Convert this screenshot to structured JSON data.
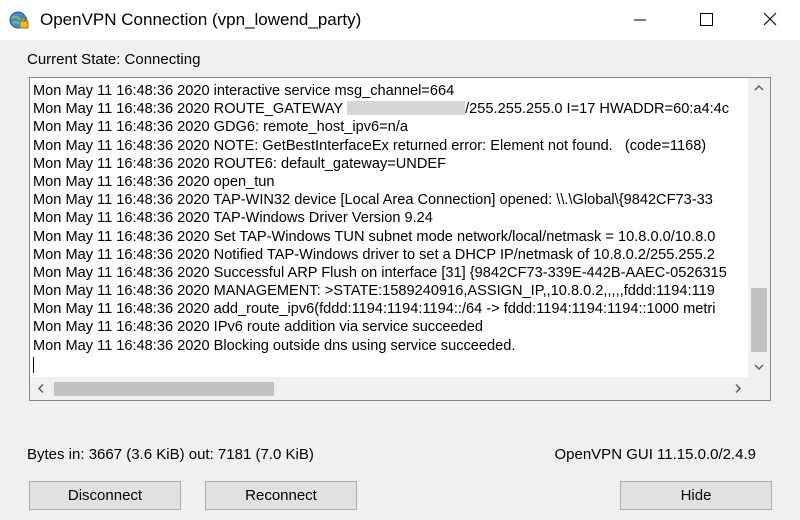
{
  "window": {
    "title": "OpenVPN Connection (vpn_lowend_party)"
  },
  "icons": {
    "app": "openvpn-globe-lock-icon",
    "minimize": "minimize-icon",
    "maximize": "maximize-icon",
    "close": "close-icon"
  },
  "state": {
    "text": "Current State: Connecting"
  },
  "log": {
    "lines": [
      "Mon May 11 16:48:36 2020 interactive service msg_channel=664",
      "Mon May 11 16:48:36 2020 ROUTE_GATEWAY",
      "Mon May 11 16:48:36 2020 GDG6: remote_host_ipv6=n/a",
      "Mon May 11 16:48:36 2020 NOTE: GetBestInterfaceEx returned error: Element not found.   (code=1168)",
      "Mon May 11 16:48:36 2020 ROUTE6: default_gateway=UNDEF",
      "Mon May 11 16:48:36 2020 open_tun",
      "Mon May 11 16:48:36 2020 TAP-WIN32 device [Local Area Connection] opened: \\\\.\\Global\\{9842CF73-33",
      "Mon May 11 16:48:36 2020 TAP-Windows Driver Version 9.24",
      "Mon May 11 16:48:36 2020 Set TAP-Windows TUN subnet mode network/local/netmask = 10.8.0.0/10.8.0",
      "Mon May 11 16:48:36 2020 Notified TAP-Windows driver to set a DHCP IP/netmask of 10.8.0.2/255.255.2",
      "Mon May 11 16:48:36 2020 Successful ARP Flush on interface [31] {9842CF73-339E-442B-AAEC-0526315",
      "Mon May 11 16:48:36 2020 MANAGEMENT: >STATE:1589240916,ASSIGN_IP,,10.8.0.2,,,,,fddd:1194:119",
      "Mon May 11 16:48:36 2020 add_route_ipv6(fddd:1194:1194:1194::/64 -> fddd:1194:1194:1194::1000 metri",
      "Mon May 11 16:48:36 2020 IPv6 route addition via service succeeded",
      "Mon May 11 16:48:36 2020 Blocking outside dns using service succeeded."
    ],
    "route_gateway_tail": "/255.255.255.0 I=17 HWADDR=60:a4:4c"
  },
  "stats": {
    "bytes": "Bytes in: 3667 (3.6 KiB)  out: 7181 (7.0 KiB)",
    "version": "OpenVPN GUI 11.15.0.0/2.4.9"
  },
  "buttons": {
    "disconnect": "Disconnect",
    "reconnect": "Reconnect",
    "hide": "Hide"
  }
}
